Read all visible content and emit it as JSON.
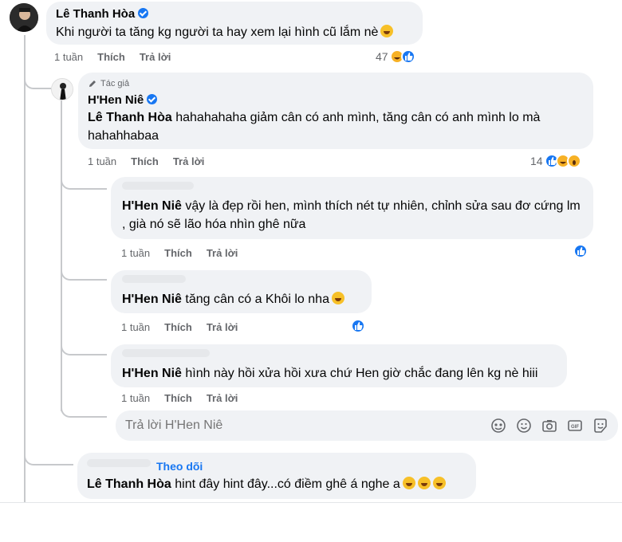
{
  "comment1": {
    "author": "Lê Thanh Hòa",
    "text": "Khi người ta tăng kg người ta hay xem lại hình cũ lắm nè",
    "time": "1 tuần",
    "like": "Thích",
    "reply": "Trả lời",
    "reaction_count": "47",
    "reactions": [
      "haha-icon",
      "like-icon"
    ]
  },
  "comment2": {
    "badge": "Tác giả",
    "author": "H'Hen Niê",
    "mention": "Lê Thanh Hòa",
    "text": "hahahahaha giảm cân có anh mình, tăng cân có anh mình lo mà hahahhabaa",
    "time": "1 tuần",
    "like": "Thích",
    "reply": "Trả lời",
    "reaction_count": "14",
    "reactions": [
      "like-icon",
      "haha-icon",
      "wow-icon"
    ]
  },
  "reply1": {
    "mention": "H'Hen Niê",
    "text": "vậy là đẹp rồi hen, mình thích nét tự nhiên, chỉnh sửa sau đơ cứng lm , già nó sẽ lão hóa nhìn ghê nữa",
    "time": "1 tuần",
    "like": "Thích",
    "reply": "Trả lời"
  },
  "reply2": {
    "mention": "H'Hen Niê",
    "text": "tăng cân có a Khôi lo nha",
    "time": "1 tuần",
    "like": "Thích",
    "reply": "Trả lời"
  },
  "reply3": {
    "mention": "H'Hen Niê",
    "text": "hình này hồi xửa hồi xưa chứ Hen giờ chắc đang lên kg nè hiii",
    "time": "1 tuần",
    "like": "Thích",
    "reply": "Trả lời"
  },
  "reply_box": {
    "placeholder": "Trả lời H'Hen Niê",
    "tools": [
      "avatar-sticker-icon",
      "emoji-icon",
      "camera-icon",
      "gif-icon",
      "sticker-icon"
    ]
  },
  "comment3": {
    "follow": "Theo dõi",
    "mention": "Lê Thanh Hòa",
    "text": "hint đây hint đây...có điềm ghê á nghe a"
  },
  "colors": {
    "bubble": "#f0f2f5",
    "accent": "#1877f2",
    "meta": "#65676b",
    "thread_line": "#c7c9cc"
  }
}
